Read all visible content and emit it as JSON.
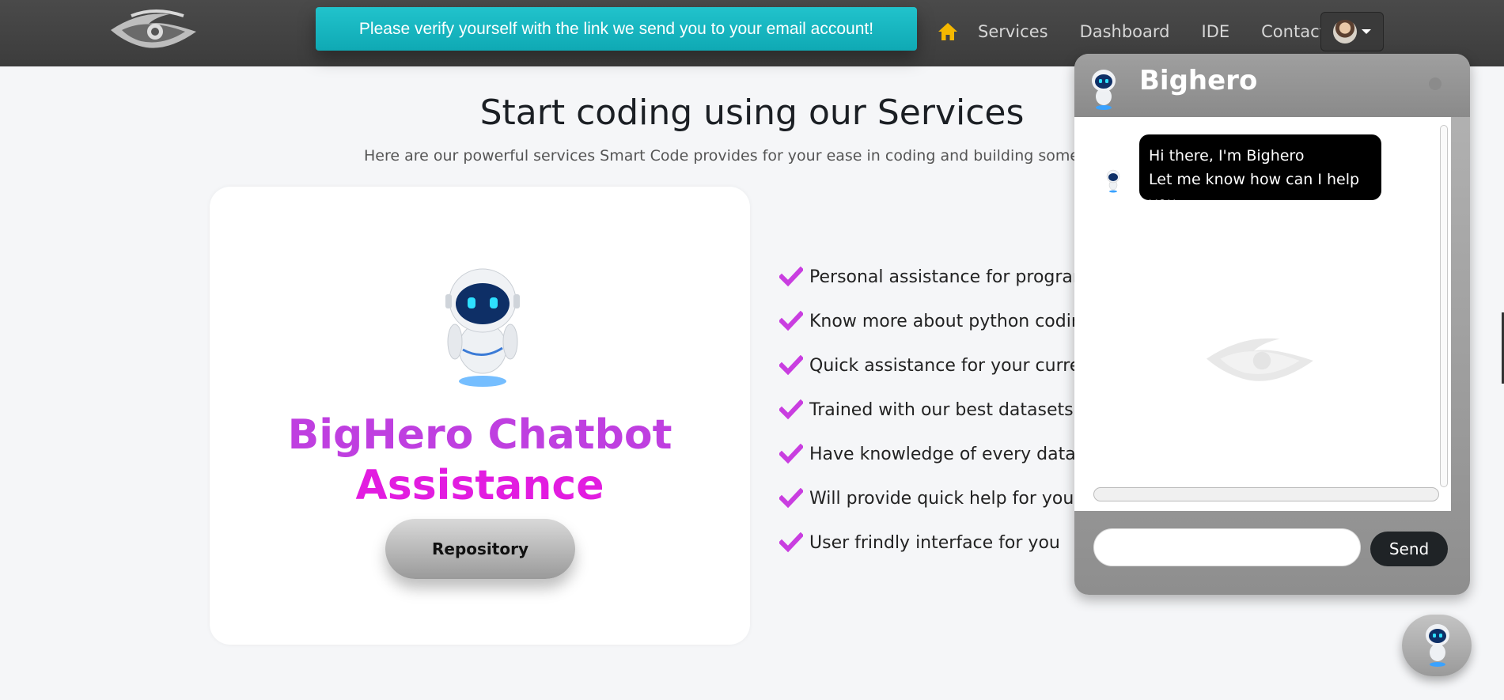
{
  "navbar": {
    "logo_icon": "eye-logo-icon",
    "verify_message": "Please verify yourself with the link we send you to your email account!",
    "home_icon": "home-icon",
    "home_color": "#f5b800",
    "links": [
      "Services",
      "Dashboard",
      "IDE",
      "Contact"
    ],
    "profile_icon": "user-avatar"
  },
  "main": {
    "title": "Start coding using our Services",
    "subtitle": "Here are our powerful services Smart Code provides for your ease in coding and building something in",
    "card": {
      "robot_icon": "robot-icon",
      "title_line1": "BigHero Chatbot",
      "title_line2": "Assistance",
      "button_label": "Repository"
    },
    "features": [
      "Personal assistance for programm",
      "Know more about python coding",
      "Quick assistance for your current p",
      "Trained with our best datasets",
      "Have knowledge of every data stru",
      "Will provide quick help for you",
      "User frindly interface for you"
    ],
    "check_color": "#c93ee0"
  },
  "chat": {
    "title": "Bighero",
    "message_line1": "Hi there, I'm Bighero",
    "message_line2": "Let me know how can I help you",
    "input_value": "",
    "send_label": "Send"
  },
  "fab": {
    "icon": "robot-icon"
  }
}
